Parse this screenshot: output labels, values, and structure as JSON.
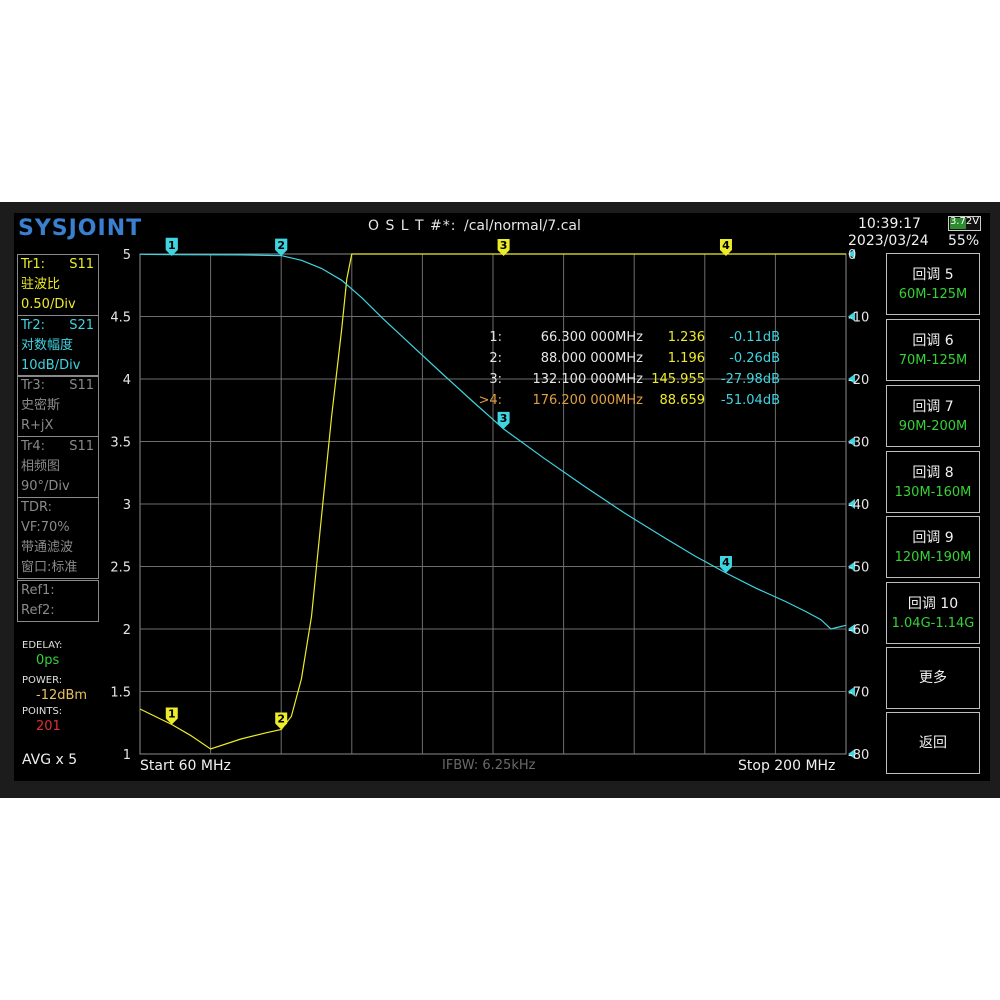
{
  "header": {
    "logo": "SYSJOINT",
    "cal_status": "O S L T #*:",
    "cal_file": "/cal/normal/7.cal",
    "time": "10:39:17",
    "date": "2023/03/24",
    "battery_voltage": "3.72V",
    "battery_percent": "55%",
    "battery_level": 0.55
  },
  "traces": [
    {
      "name": "Tr1:",
      "param": "S11",
      "format": "驻波比",
      "scale": "0.50/Div",
      "color": "#ecec2a",
      "active": true
    },
    {
      "name": "Tr2:",
      "param": "S21",
      "format": "对数幅度",
      "scale": "10dB/Div",
      "color": "#3fd4e0",
      "active": true
    },
    {
      "name": "Tr3:",
      "param": "S11",
      "format": "史密斯",
      "scale": "R+jX",
      "color": "#8a8a8a",
      "active": false
    },
    {
      "name": "Tr4:",
      "param": "S11",
      "format": "相频图",
      "scale": "90°/Div",
      "color": "#8a8a8a",
      "active": false
    }
  ],
  "tdr": {
    "title": "TDR:",
    "vf": "VF:70%",
    "mode": "带通滤波",
    "window": "窗口:标准"
  },
  "refs": {
    "ref1": "Ref1:",
    "ref2": "Ref2:"
  },
  "settings": {
    "edelay_label": "EDELAY:",
    "edelay_value": "0ps",
    "power_label": "POWER:",
    "power_value": "-12dBm",
    "points_label": "POINTS:",
    "points_value": "201",
    "avg": "AVG x 5"
  },
  "softkeys": [
    {
      "title": "回调 5",
      "sub": "60M-125M"
    },
    {
      "title": "回调 6",
      "sub": "70M-125M"
    },
    {
      "title": "回调 7",
      "sub": "90M-200M"
    },
    {
      "title": "回调 8",
      "sub": "130M-160M"
    },
    {
      "title": "回调 9",
      "sub": "120M-190M"
    },
    {
      "title": "回调 10",
      "sub": "1.04G-1.14G"
    }
  ],
  "softkey_more": "更多",
  "softkey_back": "返回",
  "footer": {
    "start": "Start   60 MHz",
    "ifbw": "IFBW: 6.25kHz",
    "stop": "Stop   200 MHz"
  },
  "markers": [
    {
      "id": "1:",
      "freq": "66.300 000MHz",
      "vswr": "1.236",
      "s21": "-0.11dB",
      "active": false
    },
    {
      "id": "2:",
      "freq": "88.000 000MHz",
      "vswr": "1.196",
      "s21": "-0.26dB",
      "active": false
    },
    {
      "id": "3:",
      "freq": "132.100 000MHz",
      "vswr": "145.955",
      "s21": "-27.98dB",
      "active": false
    },
    {
      "id": ">4:",
      "freq": "176.200 000MHz",
      "vswr": "88.659",
      "s21": "-51.04dB",
      "active": true
    }
  ],
  "colors": {
    "yellow": "#ecec2a",
    "cyan": "#3fd4e0",
    "active_marker": "#e0a040",
    "softkey_sub": "#36d236",
    "logo": "#3a7fd0"
  },
  "chart_data": {
    "type": "line",
    "x_range": [
      60,
      200
    ],
    "x_unit": "MHz",
    "left_axis": {
      "ticks": [
        "5",
        "4.5",
        "4",
        "3.5",
        "3",
        "2.5",
        "2",
        "1.5",
        "1"
      ],
      "ylim": [
        1,
        5
      ]
    },
    "right_axis": {
      "ticks": [
        "0",
        "-10",
        "-20",
        "-30",
        "-40",
        "-50",
        "-60",
        "-70",
        "-80"
      ],
      "ylim": [
        -80,
        0
      ]
    },
    "grid": true,
    "series": [
      {
        "axis": "left",
        "color": "#ecec2a",
        "x": [
          60,
          66.3,
          70,
          74,
          80,
          85,
          88,
          90,
          92,
          94,
          96,
          98,
          100,
          101,
          102,
          103,
          104,
          200
        ],
        "y": [
          1.36,
          1.236,
          1.15,
          1.04,
          1.12,
          1.17,
          1.196,
          1.3,
          1.6,
          2.1,
          2.9,
          3.7,
          4.4,
          4.8,
          5.0,
          5.0,
          5.0,
          5.0
        ]
      },
      {
        "axis": "right",
        "color": "#3fd4e0",
        "x": [
          60,
          66.3,
          80,
          88,
          92,
          96,
          100,
          104,
          108,
          114,
          120,
          126,
          132.1,
          140,
          148,
          156,
          164,
          170,
          176.2,
          182,
          188,
          192,
          195,
          197,
          199,
          200
        ],
        "y": [
          -0.05,
          -0.11,
          -0.15,
          -0.26,
          -1.0,
          -2.3,
          -4.2,
          -7.0,
          -10.2,
          -14.7,
          -19.2,
          -23.6,
          -27.98,
          -32.6,
          -37.1,
          -41.4,
          -45.4,
          -48.3,
          -51.04,
          -53.4,
          -55.6,
          -57.2,
          -58.5,
          -60.0,
          -59.6,
          -59.4
        ]
      }
    ],
    "chart_markers": [
      {
        "label": "1",
        "x": 66.3,
        "trace": "left",
        "value": 1.236
      },
      {
        "label": "2",
        "x": 88.0,
        "trace": "left",
        "value": 1.196
      },
      {
        "label": "1",
        "x": 66.3,
        "trace": "right",
        "value": -0.11
      },
      {
        "label": "2",
        "x": 88.0,
        "trace": "right",
        "value": -0.26
      },
      {
        "label": "3",
        "x": 132.1,
        "trace": "right",
        "value": -27.98
      },
      {
        "label": "4",
        "x": 176.2,
        "trace": "right",
        "value": -51.04
      }
    ]
  }
}
